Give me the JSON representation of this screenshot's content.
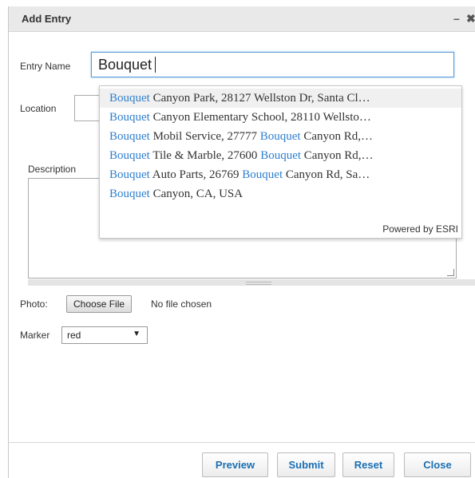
{
  "window": {
    "title": "Add Entry",
    "minimize_label": "–",
    "close_label": "✖"
  },
  "form": {
    "entry_name_label": "Entry Name",
    "entry_name_value": "Bouquet",
    "location_label": "Location",
    "description_label": "Description",
    "photo_label": "Photo:",
    "choose_file_label": "Choose File",
    "no_file_text": "No file chosen",
    "marker_label": "Marker",
    "marker_value": "red"
  },
  "autocomplete": {
    "query": "Bouquet",
    "powered_by": "Powered by ESRI",
    "items": [
      {
        "parts": [
          {
            "t": "Bouquet",
            "hl": true
          },
          {
            "t": " Canyon Park, 28127 Wellston Dr, Santa Cl…",
            "hl": false
          }
        ]
      },
      {
        "parts": [
          {
            "t": "Bouquet",
            "hl": true
          },
          {
            "t": " Canyon Elementary School, 28110 Wellsto…",
            "hl": false
          }
        ]
      },
      {
        "parts": [
          {
            "t": "Bouquet",
            "hl": true
          },
          {
            "t": " Mobil Service, 27777 ",
            "hl": false
          },
          {
            "t": "Bouquet",
            "hl": true
          },
          {
            "t": " Canyon Rd,…",
            "hl": false
          }
        ]
      },
      {
        "parts": [
          {
            "t": "Bouquet",
            "hl": true
          },
          {
            "t": " Tile & Marble, 27600 ",
            "hl": false
          },
          {
            "t": "Bouquet",
            "hl": true
          },
          {
            "t": " Canyon Rd,…",
            "hl": false
          }
        ]
      },
      {
        "parts": [
          {
            "t": "Bouquet",
            "hl": true
          },
          {
            "t": " Auto Parts, 26769 ",
            "hl": false
          },
          {
            "t": "Bouquet",
            "hl": true
          },
          {
            "t": " Canyon Rd, Sa…",
            "hl": false
          }
        ]
      },
      {
        "parts": [
          {
            "t": "Bouquet",
            "hl": true
          },
          {
            "t": " Canyon, CA, USA",
            "hl": false
          }
        ]
      }
    ]
  },
  "footer": {
    "preview_label": "Preview",
    "submit_label": "Submit",
    "reset_label": "Reset",
    "close_label": "Close"
  },
  "colors": {
    "highlight": "#2f7fcf",
    "button_text": "#1a6fb5"
  }
}
